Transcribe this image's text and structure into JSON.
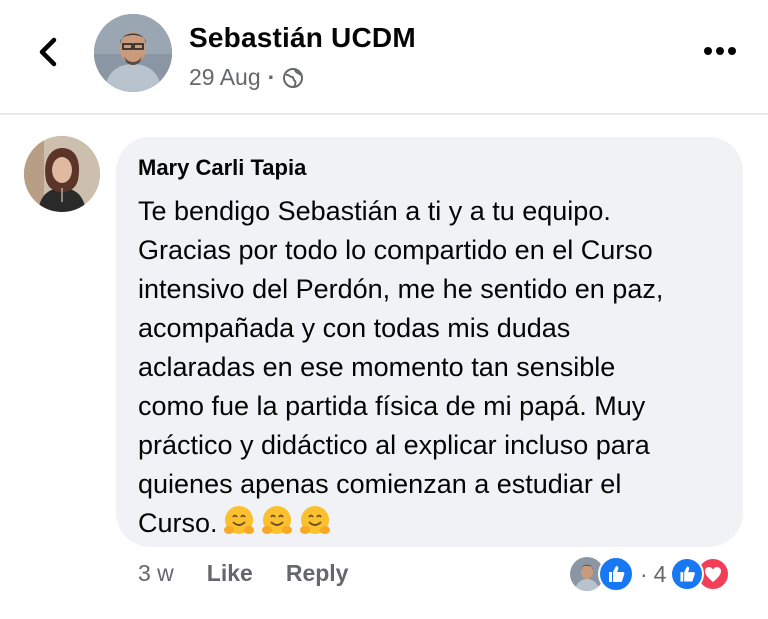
{
  "post": {
    "author": "Sebastián UCDM",
    "date": "29 Aug",
    "separator": "·",
    "audience_icon": "globe-icon"
  },
  "nav": {
    "back_icon": "chevron-left-icon",
    "more_icon": "more-horizontal-icon"
  },
  "comment": {
    "author": "Mary Carli Tapia",
    "text": "Te bendigo Sebastián a ti y a tu equipo.\nGracias por todo lo compartido en el Curso\nintensivo del Perdón, me he sentido en paz,\nacompañada y con todas mis dudas\naclaradas en ese momento tan sensible\ncomo fue la partida física de mi papá. Muy\npráctico y didáctico al explicar incluso para\nquienes apenas comienzan a estudiar el\nCurso.",
    "emoji": [
      "hugging-face-emoji",
      "hugging-face-emoji",
      "hugging-face-emoji"
    ],
    "time": "3 w",
    "like_label": "Like",
    "reply_label": "Reply",
    "reactions": {
      "separator": "·",
      "count": "4",
      "types": [
        "like",
        "love"
      ]
    }
  },
  "colors": {
    "bubble": "#f0f2f5",
    "secondary_text": "#65676b",
    "like_blue": "#1877f2",
    "love_red": "#f33e58"
  }
}
